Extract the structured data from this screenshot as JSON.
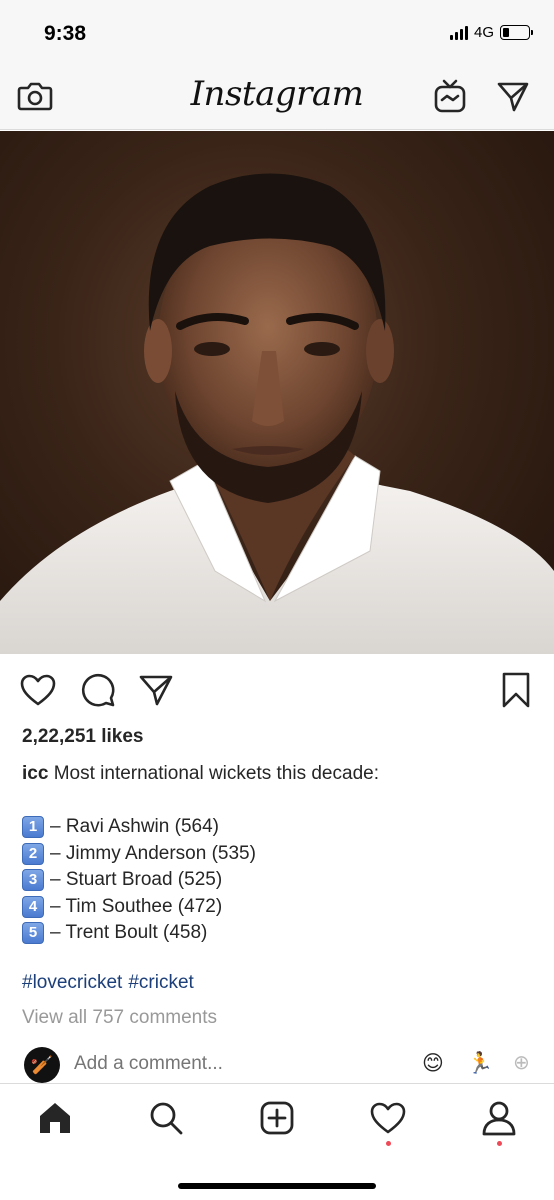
{
  "status_bar": {
    "time": "9:38",
    "network": "4G",
    "battery_level": 0.25
  },
  "header": {
    "logo": "Instagram",
    "icons": [
      "camera-icon",
      "igtv-icon",
      "direct-message-icon"
    ]
  },
  "post": {
    "image": {
      "subject": "portrait-photo"
    },
    "actions": {
      "icons": [
        "heart-icon",
        "comment-icon",
        "share-icon",
        "bookmark-icon"
      ]
    },
    "likes": "2,22,251 likes",
    "username": "icc",
    "caption_intro": "Most international wickets this decade:",
    "rankings": [
      {
        "key": "1",
        "text": "– Ravi Ashwin (564)"
      },
      {
        "key": "2",
        "text": "– Jimmy Anderson (535)"
      },
      {
        "key": "3",
        "text": "– Stuart Broad (525)"
      },
      {
        "key": "4",
        "text": "– Tim Southee (472)"
      },
      {
        "key": "5",
        "text": "– Trent Boult (458)"
      }
    ],
    "hashtags": [
      "#lovecricket",
      "#cricket"
    ],
    "view_comments": "View all 757 comments",
    "add_comment_placeholder": "Add a comment...",
    "quick_reactions": [
      "😊",
      "🏃",
      "⊕"
    ]
  },
  "tab_bar": {
    "tabs": [
      "home-icon",
      "search-icon",
      "new-post-icon",
      "activity-icon",
      "profile-icon"
    ],
    "notification_color": "#ed4956"
  },
  "colors": {
    "hashtag": "#1c3f7a",
    "muted": "#999999",
    "text": "#262626"
  }
}
